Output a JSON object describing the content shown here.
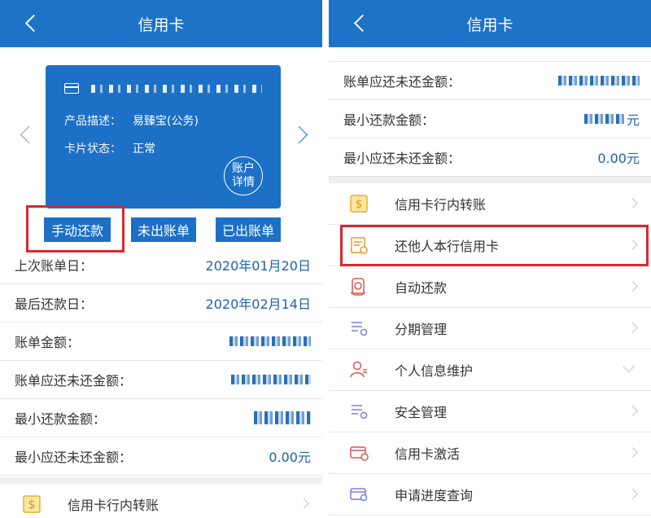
{
  "left": {
    "header_title": "信用卡",
    "card": {
      "product_label": "产品描述：",
      "product_value": "易臻宝(公务)",
      "status_label": "卡片状态：",
      "status_value": "正常",
      "account_detail": "账户详情"
    },
    "buttons": {
      "manual_repay": "手动还款",
      "unbilled": "未出账单",
      "billed": "已出账单"
    },
    "rows": [
      {
        "label": "上次账单日：",
        "value": "2020年01月20日"
      },
      {
        "label": "最后还款日：",
        "value": "2020年02月14日"
      },
      {
        "label": "账单金额：",
        "value": ""
      },
      {
        "label": "账单应还未还金额：",
        "value": ""
      },
      {
        "label": "最小还款金额：",
        "value": ""
      },
      {
        "label": "最小应还未还金额：",
        "value": "0.00元"
      }
    ],
    "menu": [
      {
        "label": "信用卡行内转账",
        "icon": "dollar-icon"
      }
    ]
  },
  "right": {
    "header_title": "信用卡",
    "rows": [
      {
        "label": "账单应还未还金额：",
        "value": ""
      },
      {
        "label": "最小还款金额：",
        "value": "元"
      },
      {
        "label": "最小应还未还金额：",
        "value": "0.00元"
      }
    ],
    "menu": [
      {
        "label": "信用卡行内转账",
        "icon": "dollar-icon"
      },
      {
        "label": "还他人本行信用卡",
        "icon": "bill-icon"
      },
      {
        "label": "自动还款",
        "icon": "auto-repay-icon"
      },
      {
        "label": "分期管理",
        "icon": "list-gear-icon"
      },
      {
        "label": "个人信息维护",
        "icon": "person-icon"
      },
      {
        "label": "安全管理",
        "icon": "list-gear-icon"
      },
      {
        "label": "信用卡激活",
        "icon": "card-check-icon"
      },
      {
        "label": "申请进度查询",
        "icon": "card-search-icon"
      }
    ]
  },
  "colors": {
    "primary": "#1c73c8",
    "highlight": "#d9272d",
    "value_text": "#1c63b0"
  }
}
